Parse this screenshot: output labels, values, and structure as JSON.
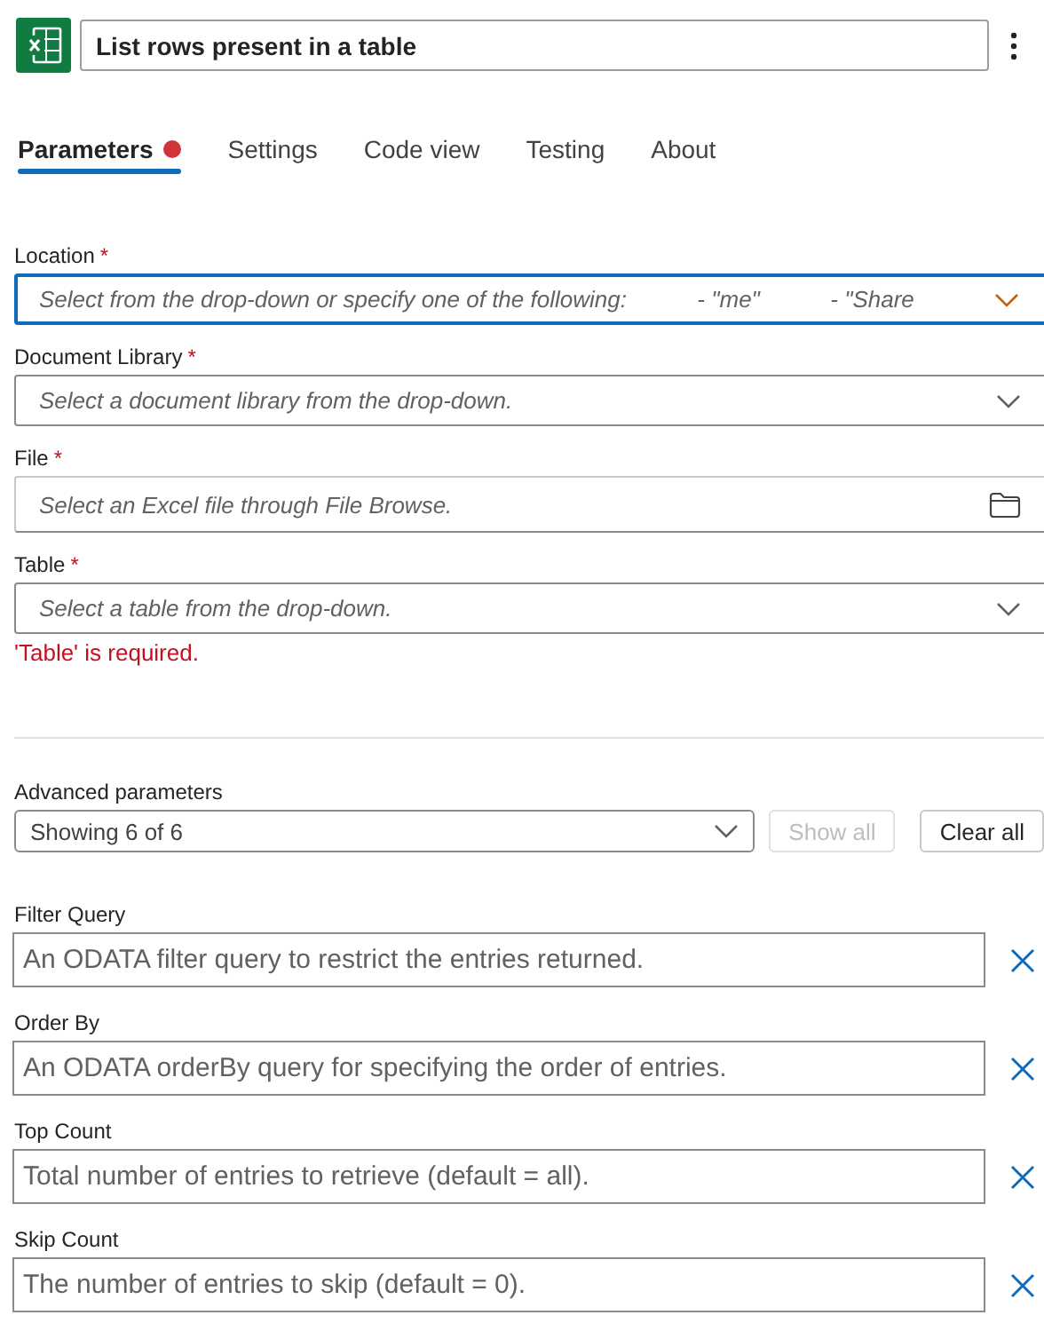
{
  "header": {
    "title": "List rows present in a table"
  },
  "tabs": [
    {
      "label": "Parameters",
      "selected": true,
      "has_error": true
    },
    {
      "label": "Settings",
      "selected": false,
      "has_error": false
    },
    {
      "label": "Code view",
      "selected": false,
      "has_error": false
    },
    {
      "label": "Testing",
      "selected": false,
      "has_error": false
    },
    {
      "label": "About",
      "selected": false,
      "has_error": false
    }
  ],
  "fields": [
    {
      "label": "Location",
      "required_mark": "*",
      "kind": "dropdown",
      "focused": true,
      "placeholder": "Select from the drop-down or specify one of the following:           - \"me\"           - \"Share"
    },
    {
      "label": "Document Library",
      "required_mark": "*",
      "kind": "dropdown",
      "focused": false,
      "placeholder": "Select a document library from the drop-down."
    },
    {
      "label": "File",
      "required_mark": "*",
      "kind": "file",
      "focused": false,
      "placeholder": "Select an Excel file through File Browse."
    },
    {
      "label": "Table",
      "required_mark": "*",
      "kind": "dropdown",
      "focused": false,
      "placeholder": "Select a table from the drop-down.",
      "error": "'Table' is required."
    }
  ],
  "advanced": {
    "label": "Advanced parameters",
    "selector": "Showing 6 of 6",
    "buttons": [
      {
        "label": "Show all",
        "disabled": true
      },
      {
        "label": "Clear all",
        "disabled": false
      }
    ]
  },
  "advanced_fields": [
    {
      "label": "Filter Query",
      "placeholder": "An ODATA filter query to restrict the entries returned."
    },
    {
      "label": "Order By",
      "placeholder": "An ODATA orderBy query for specifying the order of entries."
    },
    {
      "label": "Top Count",
      "placeholder": "Total number of entries to retrieve (default = all)."
    },
    {
      "label": "Skip Count",
      "placeholder": "The number of entries to skip (default = 0)."
    }
  ]
}
